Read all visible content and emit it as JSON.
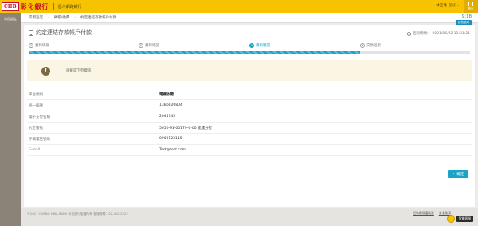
{
  "header": {
    "logo_badge": "CHB",
    "logo_text": "彰化銀行",
    "subtitle": "個人網路銀行",
    "user_text": "林宜瑾",
    "user_greeting": "您好",
    "user_suffix": "...",
    "logout_label": "登出"
  },
  "sidebar": {
    "items": [
      {
        "label": "常用設定"
      }
    ]
  },
  "breadcrumb": {
    "home": "常用設定",
    "section": "轉帳/繳費",
    "current": "約定連結存款帳戶付款"
  },
  "session": {
    "time": "9:18",
    "extend_label": "延長使用"
  },
  "page": {
    "title": "約定連結存款帳戶付款",
    "query_time_label": "查詢時間：",
    "query_time": "2021/06/22 11:31:21"
  },
  "steps": [
    {
      "num": "1",
      "label": "資料填寫",
      "state": "done"
    },
    {
      "num": "2",
      "label": "資料確認",
      "state": "done"
    },
    {
      "num": "3",
      "label": "資料確認",
      "state": "active"
    },
    {
      "num": "4",
      "label": "交易結果",
      "state": "pending"
    }
  ],
  "progress": 0.75,
  "notice": {
    "text": "請確認下列資訊"
  },
  "details": [
    {
      "key": "平台類別",
      "value": "電權依需"
    },
    {
      "key": "統一編號",
      "value": "13B6020804"
    },
    {
      "key": "電子支付名稱",
      "value": "2045145"
    },
    {
      "key": "約定帳號",
      "value": "5050-91-00179-6-00 建成分行"
    },
    {
      "key": "手機電話號碼",
      "value": "0900123115"
    },
    {
      "key": "E-mail",
      "value": "Test@test.com"
    }
  ],
  "confirm_label": "確定",
  "footer": {
    "copyright": "©2017 CHANG HWA BANK 彰化銀行版權所有     客服專線：02-412-2222",
    "links": [
      "隱私權保護政策",
      "安全政策"
    ],
    "assistant_label": "智能客服"
  },
  "colors": {
    "brand_yellow": "#f7c300",
    "accent_blue": "#1aa3c6",
    "sidebar": "#8b8378"
  }
}
